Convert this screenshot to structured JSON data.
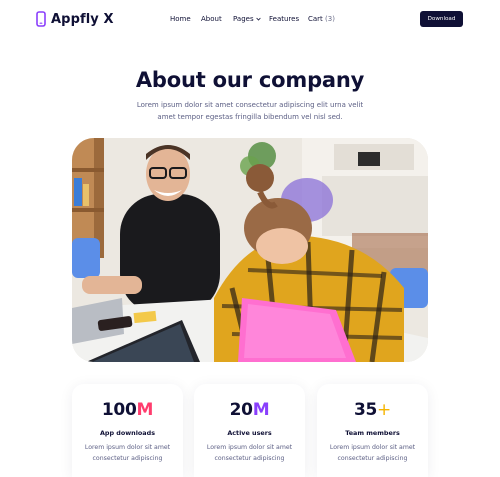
{
  "header": {
    "logo_text": "Appfly X",
    "nav": {
      "home": "Home",
      "about": "About",
      "pages": "Pages",
      "features": "Features",
      "cart_label": "Cart",
      "cart_count": "(3)"
    },
    "download_label": "Download"
  },
  "hero": {
    "title": "About our company",
    "description": "Lorem ipsum dolor sit amet consectetur adipiscing elit urna velit amet tempor egestas fringilla bibendum vel nisl sed."
  },
  "stats": [
    {
      "number": "100",
      "suffix": "M",
      "label": "App downloads",
      "description": "Lorem ipsum dolor sit amet consectetur adipiscing"
    },
    {
      "number": "20",
      "suffix": "M",
      "label": "Active users",
      "description": "Lorem ipsum dolor sit amet consectetur adipiscing"
    },
    {
      "number": "35",
      "suffix": "+",
      "label": "Team members",
      "description": "Lorem ipsum dolor sit amet consectetur adipiscing"
    }
  ],
  "colors": {
    "brand_dark": "#0f1035",
    "accent_pink": "#ff3d6e",
    "accent_purple": "#8a3ffc",
    "accent_yellow": "#f5b400",
    "logo_purple": "#8a3ffc"
  },
  "icons": {
    "logo": "phone-icon",
    "pages_dropdown": "chevron-down-icon"
  }
}
